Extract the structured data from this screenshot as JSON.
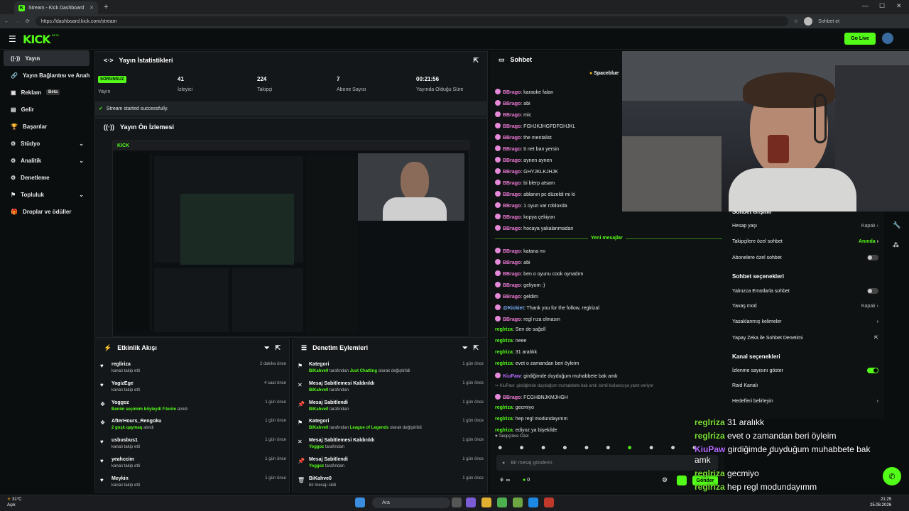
{
  "browser": {
    "tab_title": "Stream - Kick Dashboard",
    "url": "https://dashboard.kick.com/stream",
    "profile_label": "Sohbet et"
  },
  "header": {
    "logo": "KICK",
    "logo_beta": "BETA",
    "go_live": "Go Live"
  },
  "sidebar": {
    "items": [
      {
        "label": "Yayın",
        "icon": "broadcast-icon"
      },
      {
        "label": "Yayın Bağlantısı ve Anahtar",
        "icon": "link-icon"
      },
      {
        "label": "Reklam",
        "icon": "ad-icon",
        "badge": "Beta"
      },
      {
        "label": "Gelir",
        "icon": "revenue-icon"
      },
      {
        "label": "Başarılar",
        "icon": "trophy-icon"
      },
      {
        "label": "Stüdyo",
        "icon": "studio-icon"
      },
      {
        "label": "Analitik",
        "icon": "analytics-icon"
      },
      {
        "label": "Denetleme",
        "icon": "moderation-icon"
      },
      {
        "label": "Topluluk",
        "icon": "community-icon"
      },
      {
        "label": "Droplar ve ödüller",
        "icon": "gift-icon"
      }
    ]
  },
  "stats": {
    "title": "Yayın İstatistikleri",
    "status_badge": "SORUNSUZ",
    "items": [
      {
        "value": "",
        "label": "Yayın"
      },
      {
        "value": "41",
        "label": "İzleyici"
      },
      {
        "value": "224",
        "label": "Takipçi"
      },
      {
        "value": "7",
        "label": "Abone Sayısı"
      },
      {
        "value": "00:21:56",
        "label": "Yayında Olduğu Süre"
      }
    ],
    "success_msg": "Stream started successfully."
  },
  "preview": {
    "title": "Yayın Ön İzlemesi"
  },
  "activity": {
    "title": "Etkinlik Akışı",
    "rows": [
      {
        "name": "regliriza",
        "sub": "kanalı takip etti",
        "time": "2 dakika önce",
        "icon": "heart-icon"
      },
      {
        "name": "YagizEge",
        "sub": "kanalı takip etti",
        "time": "4 saat önce",
        "icon": "heart-icon"
      },
      {
        "name": "Yoggoz",
        "sub_hl": "Benim seçimim böyleydi F.terim",
        "sub": " alındı",
        "time": "1 gün önce",
        "icon": "reward-icon"
      },
      {
        "name": "AfterHours_Rengoku",
        "sub_hl": "2 goşk qaymaq",
        "sub": " alındı",
        "time": "1 gün önce",
        "icon": "reward-icon"
      },
      {
        "name": "usbusbus1",
        "sub": "kanalı takip etti",
        "time": "1 gün önce",
        "icon": "heart-icon"
      },
      {
        "name": "yeahccim",
        "sub": "kanalı takip etti",
        "time": "1 gün önce",
        "icon": "heart-icon"
      },
      {
        "name": "Meykin",
        "sub": "kanalı takip etti",
        "time": "1 gün önce",
        "icon": "heart-icon"
      }
    ]
  },
  "moderation": {
    "title": "Denetim Eylemleri",
    "rows": [
      {
        "name": "Kategori",
        "hl": "BiKahve0",
        "sub": " tarafından ",
        "hl2": "Just Chatting",
        "sub2": " olarak değiştirildi",
        "time": "1 gün önce"
      },
      {
        "name": "Mesaj Sabitlemesi Kaldırıldı",
        "hl": "BiKahve0",
        "sub": " tarafından",
        "hl2": "",
        "sub2": "",
        "time": "1 gün önce"
      },
      {
        "name": "Mesaj Sabitlendi",
        "hl": "BiKahve0",
        "sub": " tarafından",
        "hl2": "",
        "sub2": "",
        "time": "1 gün önce"
      },
      {
        "name": "Kategori",
        "hl": "BiKahve0",
        "sub": " tarafından ",
        "hl2": "League of Legends",
        "sub2": " olarak değiştirildi",
        "time": "1 gün önce"
      },
      {
        "name": "Mesaj Sabitlemesi Kaldırıldı",
        "hl": "Yoggoz",
        "sub": " tarafından",
        "hl2": "",
        "sub2": "",
        "time": "1 gün önce"
      },
      {
        "name": "Mesaj Sabitlendi",
        "hl": "Yoggoz",
        "sub": " tarafından",
        "hl2": "",
        "sub2": "",
        "time": "1 gün önce"
      },
      {
        "name": "BiKahve0",
        "hl": "",
        "sub": "bir mesajı sildi",
        "hl2": "",
        "sub2": "",
        "time": "1 gün önce"
      }
    ]
  },
  "chat": {
    "title": "Sohbet",
    "pinned_user": "Spaceblue",
    "divider": "Yeni mesajlar",
    "messages_before": [
      {
        "user": "BBrago",
        "text": "karaoke falan"
      },
      {
        "user": "BBrago",
        "text": "abi"
      },
      {
        "user": "BBrago",
        "text": "mic"
      },
      {
        "user": "BBrago",
        "text": "FGHJKJHGFDFGHJKL"
      },
      {
        "user": "BBrago",
        "text": "the mentalist"
      },
      {
        "user": "BBrago",
        "text": "tt net ban yersin"
      },
      {
        "user": "BBrago",
        "text": "aynen aynen"
      },
      {
        "user": "BBrago",
        "text": "GHYJKLKJHJK"
      },
      {
        "user": "BBrago",
        "text": "bi blerp atsam"
      },
      {
        "user": "BBrago",
        "text": "ablanın pc düzeldi mi ki"
      },
      {
        "user": "BBrago",
        "text": "1 oyun var robloxda"
      },
      {
        "user": "BBrago",
        "text": "kopya çekiyon"
      },
      {
        "user": "BBrago",
        "text": "hocaya yakalanmadan"
      }
    ],
    "messages_after": [
      {
        "user": "BBrago",
        "text": "katana mı",
        "style": "pink"
      },
      {
        "user": "BBrago",
        "text": "abi",
        "style": "pink"
      },
      {
        "user": "BBrago",
        "text": "ben o oyunu cook oynadım",
        "style": "pink"
      },
      {
        "user": "BBrago",
        "text": "geliyom :)",
        "style": "pink"
      },
      {
        "user": "BBrago",
        "text": "geldim",
        "style": "pink"
      },
      {
        "user": "@Kickiet",
        "text": "Thank you for the follow, reglrizal",
        "style": "blue"
      },
      {
        "user": "BBrago",
        "text": "regl rıza olmasın",
        "style": "pink"
      },
      {
        "user": "reglriza",
        "text": "Sen de sağoll",
        "style": "green"
      },
      {
        "user": "reglriza",
        "text": "neee",
        "style": "green"
      },
      {
        "user": "reglriza",
        "text": "31 aralıkk",
        "style": "green"
      },
      {
        "user": "reglriza",
        "text": "evet o zamandan beri öyleim",
        "style": "green"
      },
      {
        "user": "KiuPaw",
        "text": "girdiğimde duyduğum muhabbete bak amk",
        "style": "purple"
      },
      {
        "user": "BBrago",
        "text": "FCGHBNJKMJHGH",
        "style": "pink"
      },
      {
        "user": "reglriza",
        "text": "gecmiyo",
        "style": "green"
      },
      {
        "user": "reglriza",
        "text": "hep regl modundayımm",
        "style": "green"
      },
      {
        "user": "reglriza",
        "text": "ediyoz ya bişekilde",
        "style": "green"
      }
    ],
    "reply_note": "↪ KiuPaw: girdiğimde duyduğum muhabbete bak amk isimli kullanıcıya yanıt veriyor",
    "followers_only": "Takipçilere Özel",
    "input_placeholder": "Bir mesaj gönderin",
    "send": "Gönder",
    "points": "0"
  },
  "chat_settings": {
    "section1": "Sohbet erişimi",
    "rows1": [
      {
        "label": "Hesap yaşı",
        "value": "Kapalı",
        "type": "chevron"
      },
      {
        "label": "Takipçilere özel sohbet",
        "value": "Anında",
        "type": "chevron-green"
      },
      {
        "label": "Abonelere özel sohbet",
        "value": "",
        "type": "toggle-off"
      }
    ],
    "section2": "Sohbet seçenekleri",
    "rows2": [
      {
        "label": "Yalnızca Emotlarla sohbet",
        "value": "",
        "type": "toggle-off"
      },
      {
        "label": "Yavaş mod",
        "value": "Kapalı",
        "type": "chevron"
      },
      {
        "label": "Yasaklanmış kelimeler",
        "value": "",
        "type": "chevron"
      },
      {
        "label": "Yapay Zeka ile Sohbet Denetimi",
        "value": "",
        "type": "external"
      }
    ],
    "section3": "Kanal seçenekleri",
    "rows3": [
      {
        "label": "İzlenme sayısını göster",
        "value": "",
        "type": "toggle-on"
      },
      {
        "label": "Raid Kanalı",
        "value": "",
        "type": "none"
      },
      {
        "label": "Hedefleri belirleyin",
        "value": "",
        "type": "chevron"
      }
    ]
  },
  "overlay_chat": [
    {
      "user": "reglriza",
      "text": "31 aralıkk",
      "style": "green"
    },
    {
      "user": "reglriza",
      "text": "evet o zamandan beri öyleim",
      "style": "green"
    },
    {
      "user": "KiuPaw",
      "text": "girdiğimde duyduğum muhabbete bak",
      "style": "purple"
    },
    {
      "user": "",
      "text": "amk",
      "style": "cont"
    },
    {
      "user": "reglriza",
      "text": "gecmiyo",
      "style": "green"
    },
    {
      "user": "reglriza",
      "text": "hep regl modundayımm",
      "style": "green"
    },
    {
      "user": "reglriza",
      "text": "ediyoz ya bişekilde",
      "style": "green"
    }
  ],
  "taskbar": {
    "weather_temp": "31°C",
    "weather_desc": "Açık",
    "search": "Ara",
    "time": "21:25",
    "date": "25.08.2026"
  }
}
